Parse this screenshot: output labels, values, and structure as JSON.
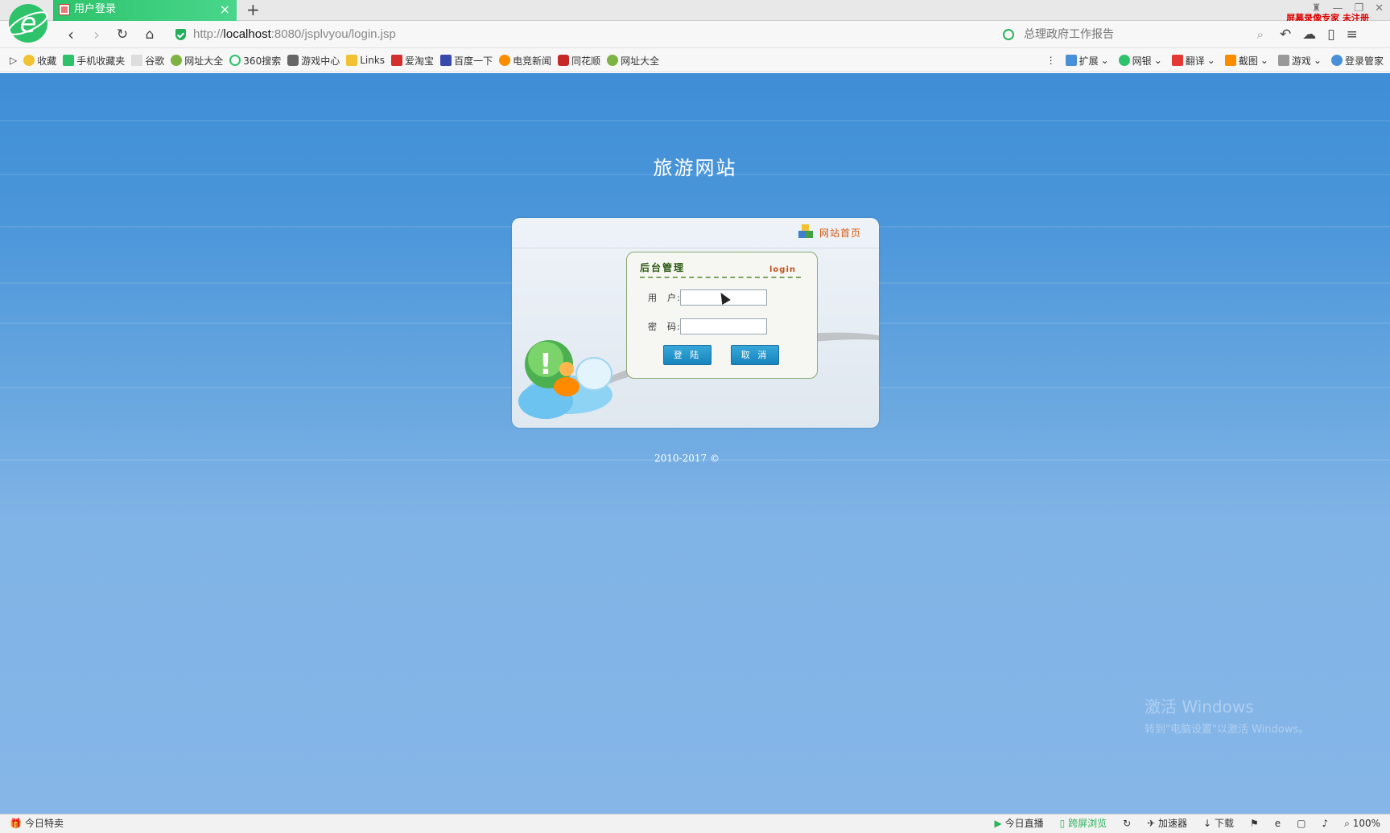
{
  "browser": {
    "tab_title": "用户登录",
    "url_prefix": "http://",
    "url_host": "localhost",
    "url_rest": ":8080/jsplvyou/login.jsp",
    "search_placeholder": "总理政府工作报告",
    "recorder_label": "屏幕录像专家 未注册",
    "bookmarks": [
      "收藏",
      "手机收藏夹",
      "谷歌",
      "网址大全",
      "360搜索",
      "游戏中心",
      "Links",
      "爱淘宝",
      "百度一下",
      "电竞新闻",
      "同花顺",
      "网址大全"
    ],
    "toolbar_right": [
      "扩展",
      "网银",
      "翻译",
      "截图",
      "游戏",
      "登录管家"
    ]
  },
  "page": {
    "site_title": "旅游网站",
    "home_link": "网站首页",
    "box_title": "后台管理",
    "box_subtitle": "login",
    "user_label": "用　户:",
    "pass_label": "密　码:",
    "user_value": "",
    "pass_value": "",
    "login_button": "登 陆",
    "cancel_button": "取 消",
    "copyright": "2010-2017 ©"
  },
  "watermark": {
    "line1": "激活 Windows",
    "line2": "转到\"电脑设置\"以激活 Windows。"
  },
  "status": {
    "left": "今日特卖",
    "right": [
      "今日直播",
      "跨屏浏览",
      "加速器",
      "下载",
      "100%"
    ]
  },
  "colors": {
    "accent": "#2ec36b",
    "page_bg_top": "#3f8ed6",
    "page_bg_bottom": "#86b6e8",
    "button": "#1785be",
    "home_link": "#d35a17"
  }
}
